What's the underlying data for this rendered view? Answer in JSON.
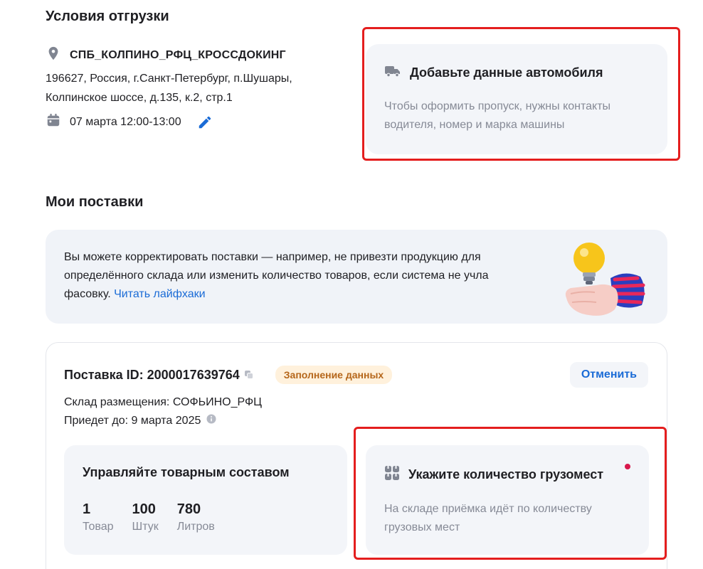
{
  "shipping": {
    "section_title": "Условия отгрузки",
    "warehouse_name": "СПБ_КОЛПИНО_РФЦ_КРОССДОКИНГ",
    "address_line1": "196627, Россия, г.Санкт-Петербург, п.Шушары,",
    "address_line2": "Колпинское шоссе, д.135, к.2, стр.1",
    "date": "07 марта 12:00-13:00"
  },
  "car_card": {
    "title": "Добавьте данные автомобиля",
    "text_line1": "Чтобы оформить пропуск, нужны контакты",
    "text_line2": "водителя, номер и марка машины"
  },
  "supplies": {
    "section_title": "Мои поставки"
  },
  "info_banner": {
    "line1": "Вы можете корректировать поставки — например, не привезти продукцию для",
    "line2": "определённого склада или изменить количество товаров, если система не учла",
    "line3": "фасовку.",
    "link": "Читать лайфхаки"
  },
  "supply": {
    "id_label": "Поставка ID: 2000017639764",
    "status": "Заполнение данных",
    "cancel_label": "Отменить",
    "warehouse": "Склад размещения: СОФЬИНО_РФЦ",
    "arrival": "Приедет до: 9 марта 2025",
    "stats": {
      "title": "Управляйте товарным составом",
      "items": [
        {
          "value": "1",
          "label": "Товар"
        },
        {
          "value": "100",
          "label": "Штук"
        },
        {
          "value": "780",
          "label": "Литров"
        }
      ]
    },
    "cargo": {
      "title": "Укажите количество грузомест",
      "text_line1": "На складе приёмка идёт по количеству",
      "text_line2": "грузовых мест"
    }
  },
  "colors": {
    "accent_blue": "#1a6bd6",
    "highlight_red": "#e41e1e",
    "badge_bg": "#fff1dc",
    "badge_text": "#b5661a",
    "card_bg": "#f3f5f9"
  }
}
